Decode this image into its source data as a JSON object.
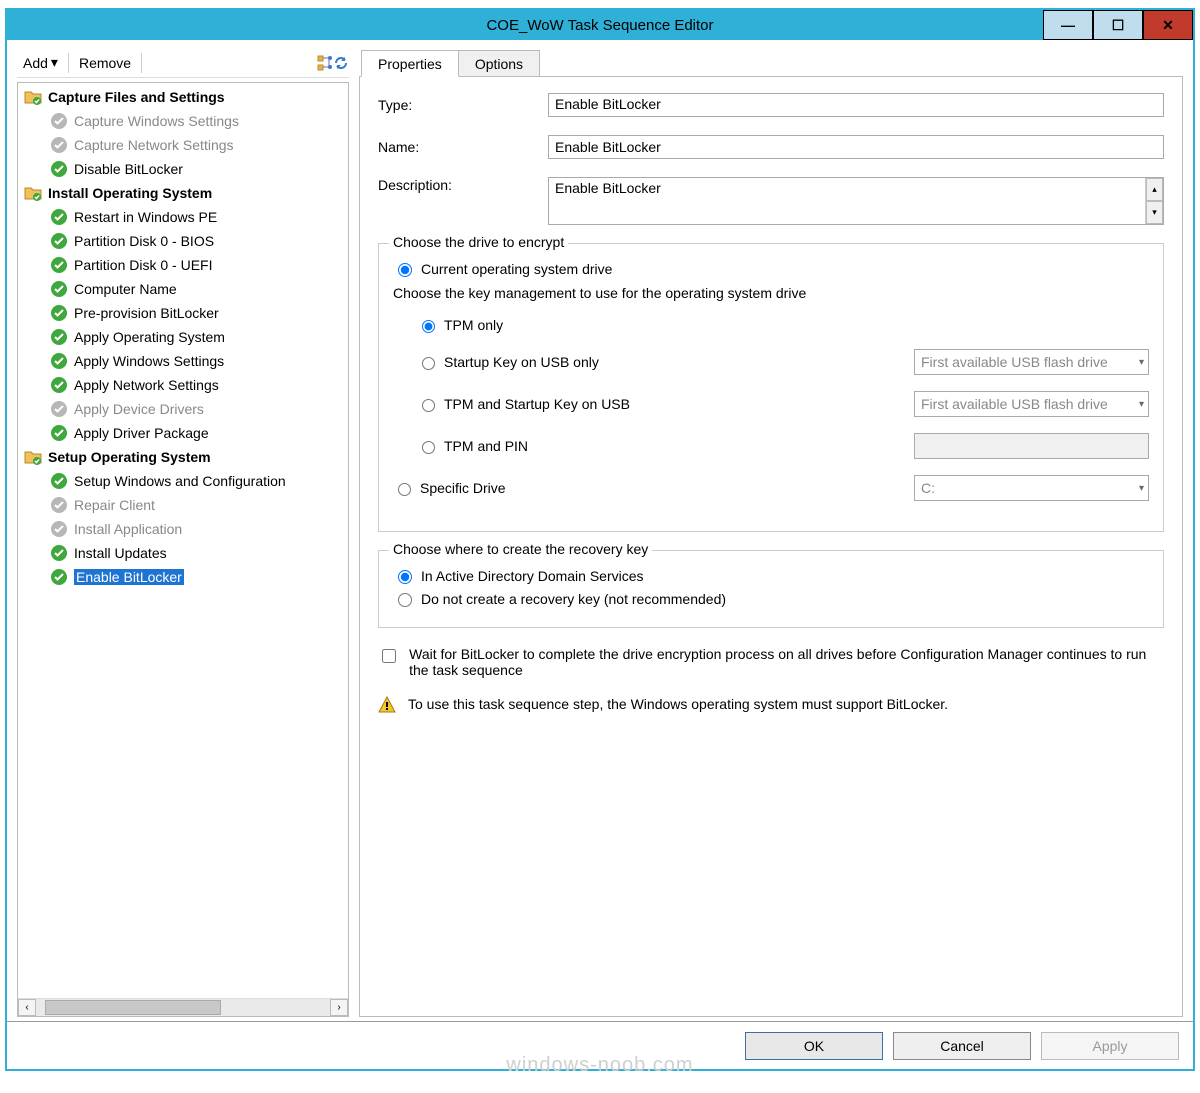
{
  "window": {
    "title": "COE_WoW Task Sequence Editor"
  },
  "toolbar": {
    "add": "Add",
    "remove": "Remove"
  },
  "tree": {
    "groups": [
      {
        "label": "Capture Files and Settings",
        "items": [
          {
            "label": "Capture Windows Settings",
            "state": "disabled"
          },
          {
            "label": "Capture Network Settings",
            "state": "disabled"
          },
          {
            "label": "Disable BitLocker",
            "state": "ok"
          }
        ]
      },
      {
        "label": "Install Operating System",
        "items": [
          {
            "label": "Restart in Windows PE",
            "state": "ok"
          },
          {
            "label": "Partition Disk 0 - BIOS",
            "state": "ok"
          },
          {
            "label": "Partition Disk 0 - UEFI",
            "state": "ok"
          },
          {
            "label": "Computer Name",
            "state": "ok"
          },
          {
            "label": "Pre-provision BitLocker",
            "state": "ok"
          },
          {
            "label": "Apply Operating System",
            "state": "ok"
          },
          {
            "label": "Apply Windows Settings",
            "state": "ok"
          },
          {
            "label": "Apply Network Settings",
            "state": "ok"
          },
          {
            "label": "Apply Device Drivers",
            "state": "disabled"
          },
          {
            "label": "Apply Driver Package",
            "state": "ok"
          }
        ]
      },
      {
        "label": "Setup Operating System",
        "items": [
          {
            "label": "Setup Windows and Configuration",
            "state": "ok"
          },
          {
            "label": "Repair Client",
            "state": "disabled"
          },
          {
            "label": "Install Application",
            "state": "disabled"
          },
          {
            "label": "Install Updates",
            "state": "ok"
          },
          {
            "label": "Enable BitLocker",
            "state": "ok",
            "selected": true
          }
        ]
      }
    ]
  },
  "tabs": {
    "properties": "Properties",
    "options": "Options"
  },
  "form": {
    "type_label": "Type:",
    "type_value": "Enable BitLocker",
    "name_label": "Name:",
    "name_value": "Enable BitLocker",
    "desc_label": "Description:",
    "desc_value": "Enable BitLocker"
  },
  "encrypt": {
    "group_title": "Choose the drive to encrypt",
    "current_os": "Current operating system drive",
    "sub_line": "Choose the key management to use for the operating system drive",
    "tpm_only": "TPM only",
    "usb_only": "Startup Key on USB only",
    "tpm_usb": "TPM and Startup Key on USB",
    "tpm_pin": "TPM and PIN",
    "specific": "Specific Drive",
    "usb_combo": "First available USB flash drive",
    "drive_combo": "C:"
  },
  "recovery": {
    "group_title": "Choose where to create the recovery key",
    "ad": "In Active Directory Domain Services",
    "none": "Do not create a recovery key (not recommended)"
  },
  "wait": {
    "label": "Wait for BitLocker to complete the drive encryption process on all drives before Configuration Manager continues to run the task sequence"
  },
  "info": {
    "text": "To use this task sequence step, the Windows operating system must support BitLocker."
  },
  "buttons": {
    "ok": "OK",
    "cancel": "Cancel",
    "apply": "Apply"
  },
  "watermark": "windows-noob.com"
}
